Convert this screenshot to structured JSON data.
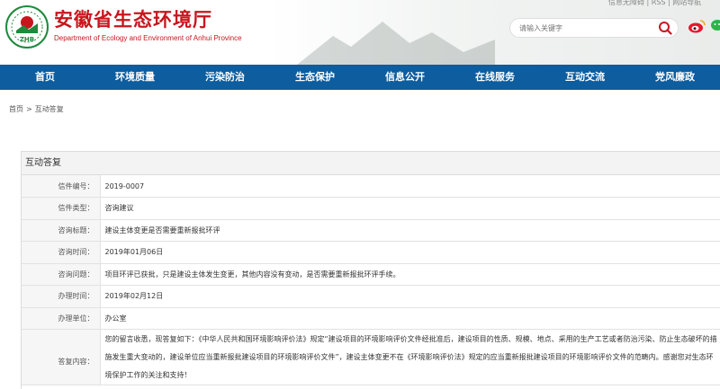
{
  "header": {
    "title": "安徽省生态环境厅",
    "subtitle": "Department of Ecology and Environment of Anhui Province",
    "logo_text": "ZHB",
    "top_links": "信息无障碍 | RSS | 网站导航",
    "search_placeholder": "请输入关键字"
  },
  "nav": {
    "items": [
      "首页",
      "环境质量",
      "污染防治",
      "生态保护",
      "信息公开",
      "在线服务",
      "互动交流",
      "党风廉政"
    ]
  },
  "breadcrumb": {
    "home": "首页",
    "separator": ">",
    "current": "互动答复"
  },
  "panel": {
    "title": "互动答复",
    "rows": [
      {
        "label": "信件编号：",
        "value": "2019-0007"
      },
      {
        "label": "信件类型：",
        "value": "咨询建议"
      },
      {
        "label": "咨询标题：",
        "value": "建设主体变更是否需要重新报批环评"
      },
      {
        "label": "咨询时间：",
        "value": "2019年01月06日"
      },
      {
        "label": "咨询问题：",
        "value": "项目环评已获批，只是建设主体发生变更，其他内容没有变动，是否需要重新报批环评手续。"
      },
      {
        "label": "办理时间：",
        "value": "2019年02月12日"
      },
      {
        "label": "办理单位：",
        "value": "办公室"
      },
      {
        "label": "答复内容：",
        "value": "您的留言收悉，现答复如下：《中华人民共和国环境影响评价法》规定“建设项目的环境影响评价文件经批准后，建设项目的性质、规模、地点、采用的生产工艺或者防治污染、防止生态破坏的措施发生重大变动的，建设单位应当重新报批建设项目的环境影响评价文件”，建设主体变更不在《环境影响评价法》规定的应当重新报批建设项目的环境影响评价文件的范畴内。感谢您对生态环境保护工作的关注和支持！"
      }
    ]
  },
  "colors": {
    "brand_red": "#c8161d",
    "nav_blue": "#0d5d9f",
    "logo_green": "#1e8a3c"
  },
  "icons": [
    "logo-emblem",
    "search-icon",
    "weibo-icon",
    "wechat-icon"
  ]
}
